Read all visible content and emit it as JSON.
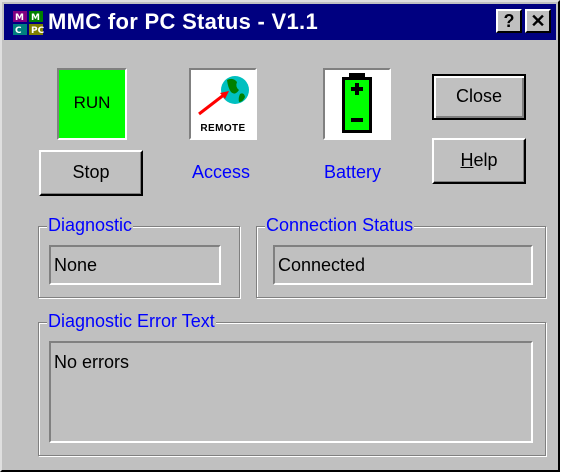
{
  "window": {
    "title": "MMC for PC Status - V1.1",
    "help_button": "?",
    "close_button": "✕"
  },
  "status": {
    "run_label": "RUN",
    "run_color": "#00ff00",
    "stop_button": "Stop",
    "access_label": "Access",
    "access_icon_text": "REMOTE",
    "battery_label": "Battery",
    "label_color": "#0000ff"
  },
  "actions": {
    "close_button": "Close",
    "help_button": "Help"
  },
  "diagnostic": {
    "group_label": "Diagnostic",
    "value": "None"
  },
  "connection": {
    "group_label": "Connection Status",
    "value": "Connected"
  },
  "error_text": {
    "group_label": "Diagnostic Error Text",
    "value": "No errors"
  }
}
